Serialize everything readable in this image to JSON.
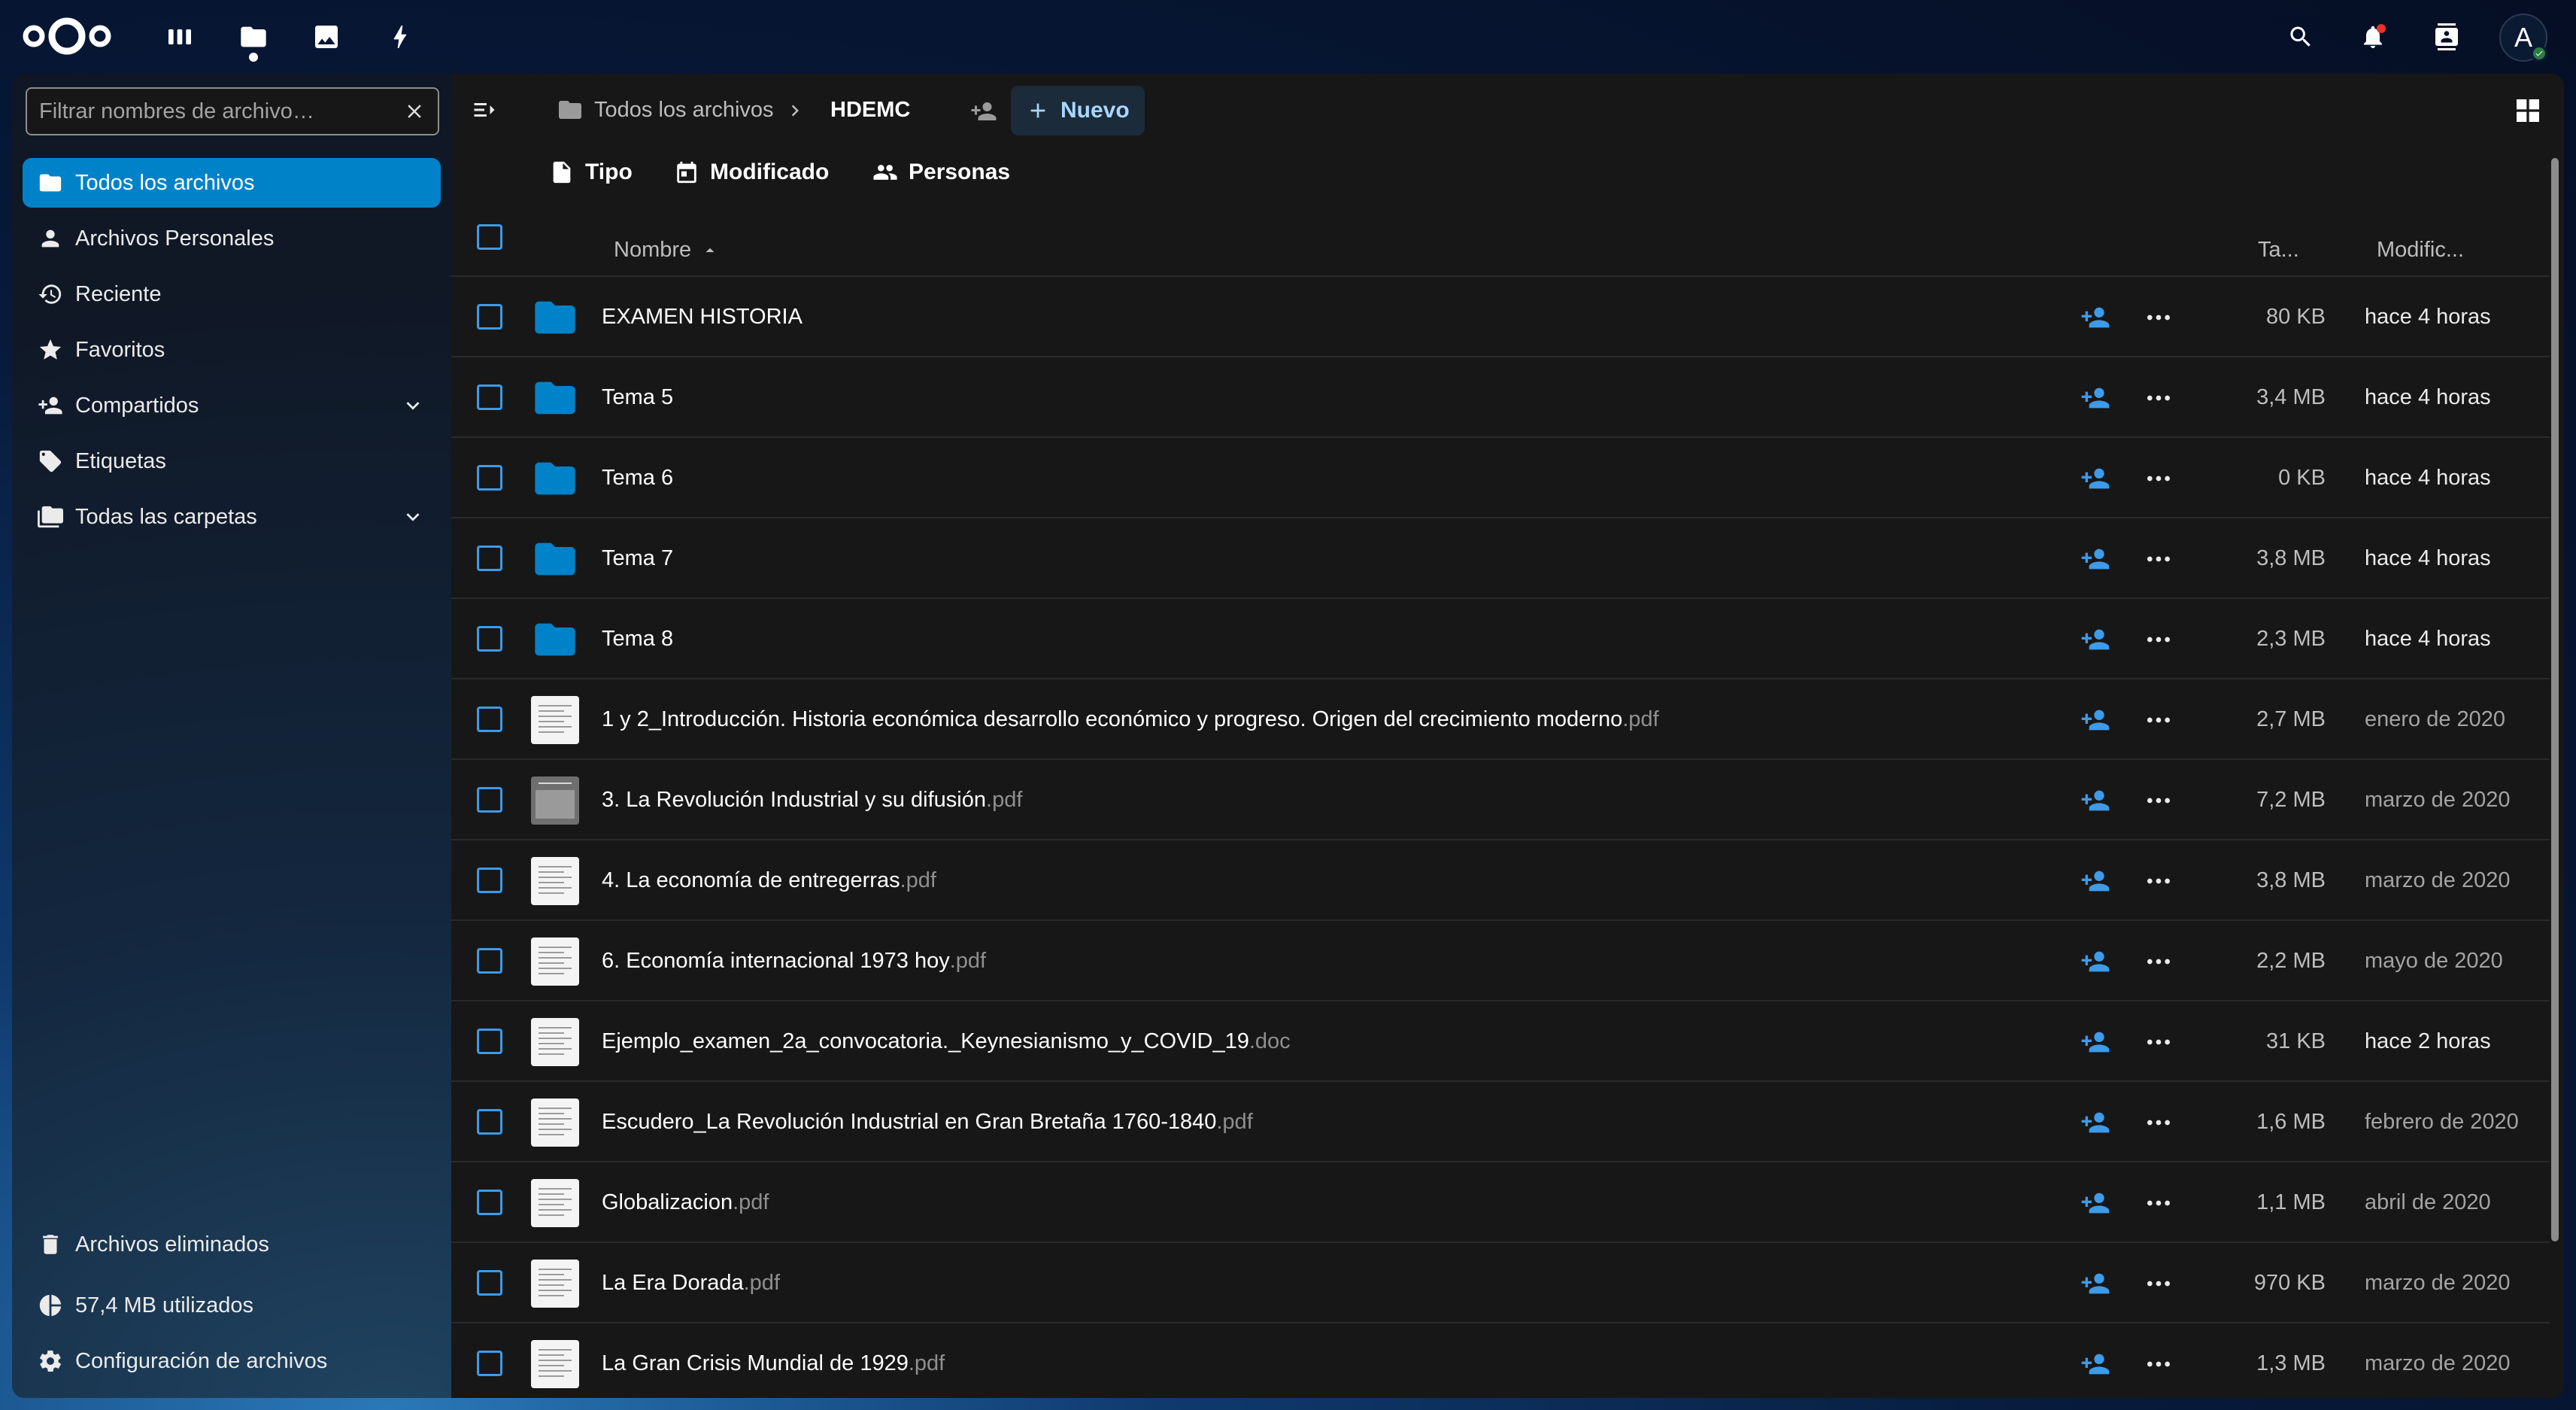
{
  "header": {
    "apps": [
      {
        "name": "dashboard",
        "icon": "dashboard-icon"
      },
      {
        "name": "files",
        "icon": "folder-icon",
        "active": true
      },
      {
        "name": "photos",
        "icon": "image-icon"
      },
      {
        "name": "activity",
        "icon": "lightning-icon"
      }
    ],
    "right": [
      "search-icon",
      "bell-icon",
      "contacts-icon"
    ],
    "avatar_letter": "A"
  },
  "sidebar": {
    "filter_placeholder": "Filtrar nombres de archivo…",
    "items": [
      {
        "label": "Todos los archivos",
        "icon": "folder-icon",
        "active": true
      },
      {
        "label": "Archivos Personales",
        "icon": "account-icon"
      },
      {
        "label": "Reciente",
        "icon": "history-icon"
      },
      {
        "label": "Favoritos",
        "icon": "star-icon"
      },
      {
        "label": "Compartidos",
        "icon": "share-icon",
        "expandable": true
      },
      {
        "label": "Etiquetas",
        "icon": "tag-icon"
      },
      {
        "label": "Todas las carpetas",
        "icon": "folder-multiple-icon",
        "expandable": true
      }
    ],
    "bottom": [
      {
        "label": "Archivos eliminados",
        "icon": "trash-icon"
      },
      {
        "label": "57,4 MB utilizados",
        "icon": "pie-chart-icon"
      },
      {
        "label": "Configuración de archivos",
        "icon": "gear-icon"
      }
    ]
  },
  "breadcrumb": {
    "root": "Todos los archivos",
    "current": "HDEMC",
    "new_label": "Nuevo"
  },
  "filters": [
    "Tipo",
    "Modificado",
    "Personas"
  ],
  "columns": {
    "name": "Nombre",
    "size": "Ta...",
    "modified": "Modific..."
  },
  "files": [
    {
      "name": "EXAMEN HISTORIA",
      "ext": "",
      "kind": "folder",
      "size": "80 KB",
      "modified": "hace 4 horas"
    },
    {
      "name": "Tema 5",
      "ext": "",
      "kind": "folder",
      "size": "3,4 MB",
      "modified": "hace 4 horas"
    },
    {
      "name": "Tema 6",
      "ext": "",
      "kind": "folder",
      "size": "0 KB",
      "modified": "hace 4 horas"
    },
    {
      "name": "Tema 7",
      "ext": "",
      "kind": "folder",
      "size": "3,8 MB",
      "modified": "hace 4 horas"
    },
    {
      "name": "Tema 8",
      "ext": "",
      "kind": "folder",
      "size": "2,3 MB",
      "modified": "hace 4 horas"
    },
    {
      "name": "1 y 2_Introducción. Historia económica desarrollo económico y progreso. Origen del crecimiento moderno",
      "ext": ".pdf",
      "kind": "doc",
      "size": "2,7 MB",
      "modified": "enero de 2020"
    },
    {
      "name": "3. La Revolución Industrial y su difusión",
      "ext": ".pdf",
      "kind": "photo",
      "size": "7,2 MB",
      "modified": "marzo de 2020"
    },
    {
      "name": "4. La economía de entregerras",
      "ext": ".pdf",
      "kind": "doc",
      "size": "3,8 MB",
      "modified": "marzo de 2020"
    },
    {
      "name": "6. Economía internacional 1973 hoy",
      "ext": ".pdf",
      "kind": "doc",
      "size": "2,2 MB",
      "modified": "mayo de 2020"
    },
    {
      "name": "Ejemplo_examen_2a_convocatoria._Keynesianismo_y_COVID_19",
      "ext": ".doc",
      "kind": "doc",
      "size": "31 KB",
      "modified": "hace 2 horas"
    },
    {
      "name": "Escudero_La Revolución Industrial en Gran Bretaña 1760-1840",
      "ext": ".pdf",
      "kind": "doc",
      "size": "1,6 MB",
      "modified": "febrero de 2020"
    },
    {
      "name": "Globalizacion",
      "ext": ".pdf",
      "kind": "doc",
      "size": "1,1 MB",
      "modified": "abril de 2020"
    },
    {
      "name": "La Era Dorada",
      "ext": ".pdf",
      "kind": "doc",
      "size": "970 KB",
      "modified": "marzo de 2020"
    },
    {
      "name": "La Gran Crisis Mundial de 1929",
      "ext": ".pdf",
      "kind": "doc",
      "size": "1,3 MB",
      "modified": "marzo de 2020"
    }
  ],
  "colors": {
    "accent": "#0082c9",
    "share": "#3d9be9",
    "background": "#171717"
  }
}
